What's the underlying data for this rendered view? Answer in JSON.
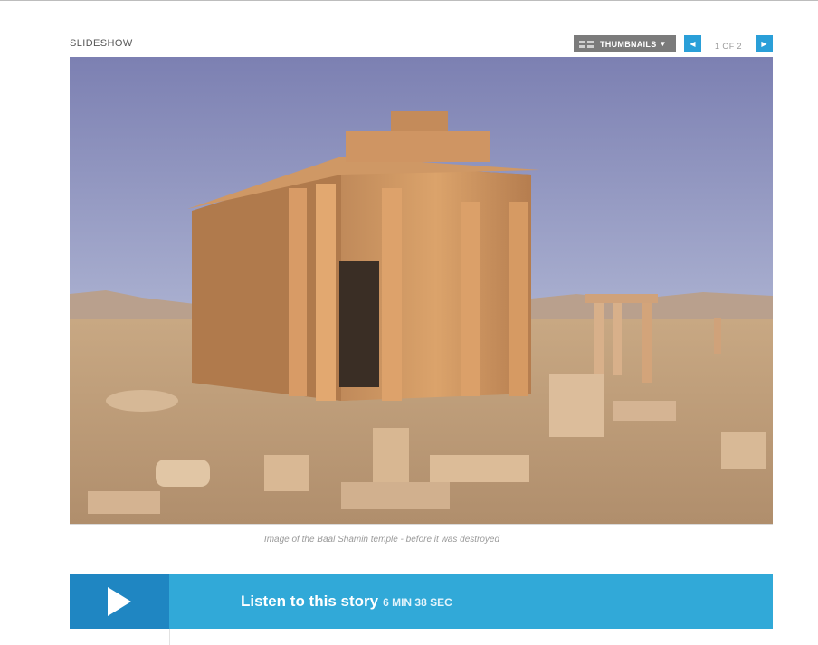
{
  "slideshow": {
    "label": "SLIDESHOW",
    "thumbnails_label": "THUMBNAILS",
    "counter": "1 OF 2"
  },
  "icons": {
    "thumbnails": "grid-icon",
    "dropdown": "caret-down-icon",
    "prev": "arrow-left-icon",
    "next": "arrow-right-icon",
    "play": "play-icon"
  },
  "image": {
    "caption": "Image of the Baal Shamin temple - before it was destroyed"
  },
  "audio": {
    "title": "Listen to this story",
    "duration": "6 MIN 38 SEC"
  },
  "colors": {
    "accent": "#31a9d8",
    "accent_dark": "#1f86c2",
    "thumbnail_button": "#7b7b7b"
  }
}
